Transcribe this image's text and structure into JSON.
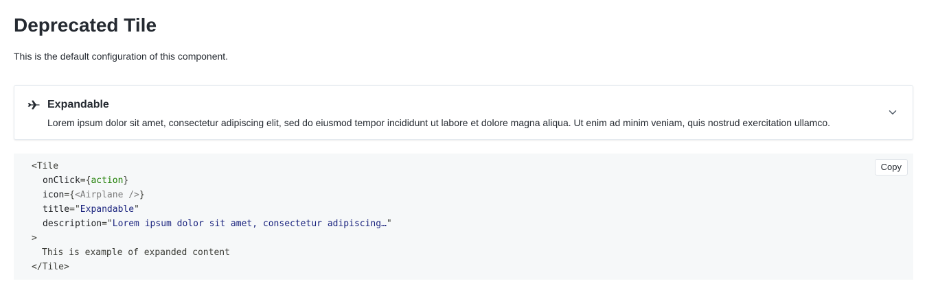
{
  "page": {
    "title": "Deprecated Tile",
    "description": "This is the default configuration of this component."
  },
  "tile": {
    "icon": "airplane-icon",
    "title": "Expandable",
    "description": "Lorem ipsum dolor sit amet, consectetur adipiscing elit, sed do eiusmod tempor incididunt ut labore et dolore magna aliqua. Ut enim ad minim veniam, quis nostrud exercitation ullamco.",
    "chevron": "chevron-down-icon"
  },
  "code": {
    "copy_label": "Copy",
    "open_tag": "<Tile",
    "attrs": {
      "onclick_name": "onClick",
      "onclick_value": "action",
      "icon_name": "icon",
      "icon_value": "<Airplane />",
      "title_name": "title",
      "title_value": "Expandable",
      "description_name": "description",
      "description_value": "Lorem ipsum dolor sit amet, consectetur adipiscing…"
    },
    "tag_end": ">",
    "content": "This is example of expanded content",
    "close_tag": "</Tile>"
  },
  "colors": {
    "text": "#252a31",
    "code_background": "#f6f8f9",
    "tile_border": "#e5eaef",
    "code_value_green": "#1c7d00",
    "code_string_blue": "#1a237e",
    "code_component_gray": "#7a7a7a"
  }
}
